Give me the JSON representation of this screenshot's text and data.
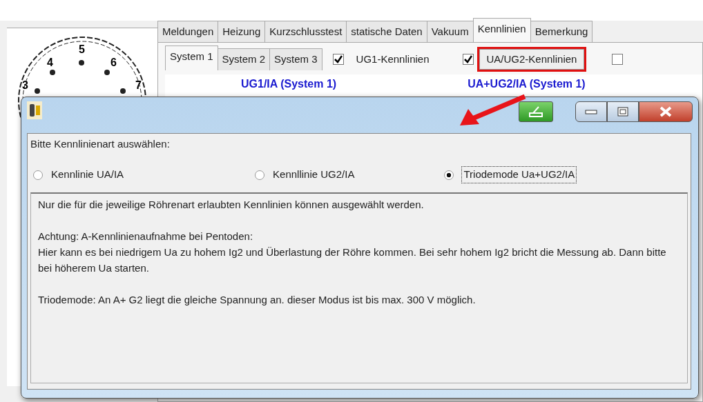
{
  "socket_pins": [
    "4",
    "5",
    "6",
    "3",
    "7"
  ],
  "tabs": [
    {
      "label": "Meldungen",
      "selected": false
    },
    {
      "label": "Heizung",
      "selected": false
    },
    {
      "label": "Kurzschlusstest",
      "selected": false
    },
    {
      "label": "statische Daten",
      "selected": false
    },
    {
      "label": "Vakuum",
      "selected": false
    },
    {
      "label": "Kennlinien",
      "selected": true
    },
    {
      "label": "Bemerkung",
      "selected": false
    }
  ],
  "subtabs": [
    {
      "label": "System 1",
      "selected": true
    },
    {
      "label": "System 2",
      "selected": false
    },
    {
      "label": "System 3",
      "selected": false
    }
  ],
  "options": [
    {
      "label": "UG1-Kennlinien",
      "checked": true
    },
    {
      "label": "UA/UG2-Kennlinien",
      "checked": true,
      "highlighted": true
    },
    {
      "checked": false
    }
  ],
  "chart_titles": [
    "UG1/IA (System 1)",
    "UA+UG2/IA (System 1)"
  ],
  "dialog": {
    "prompt": "Bitte Kennlinienart auswählen:",
    "radios": [
      {
        "label": "Kennlinie UA/IA",
        "selected": false
      },
      {
        "label": "Kennllinie UG2/IA",
        "selected": false
      },
      {
        "label": "Triodemode Ua+UG2/IA",
        "selected": true
      }
    ],
    "info": [
      "Nur die für die jeweilige Röhrenart erlaubten Kennlinien können ausgewählt werden.",
      "Achtung:  A-Kennlinienaufnahme bei Pentoden:\nHier kann es bei niedrigem Ua zu hohem Ig2 und Überlastung der Röhre kommen. Bei sehr hohem Ig2 bricht die Messung ab. Dann bitte bei höherem Ua starten.",
      "Triodemode: An A+ G2 liegt die gleiche Spannung an. dieser Modus ist bis max. 300 V möglich."
    ]
  }
}
